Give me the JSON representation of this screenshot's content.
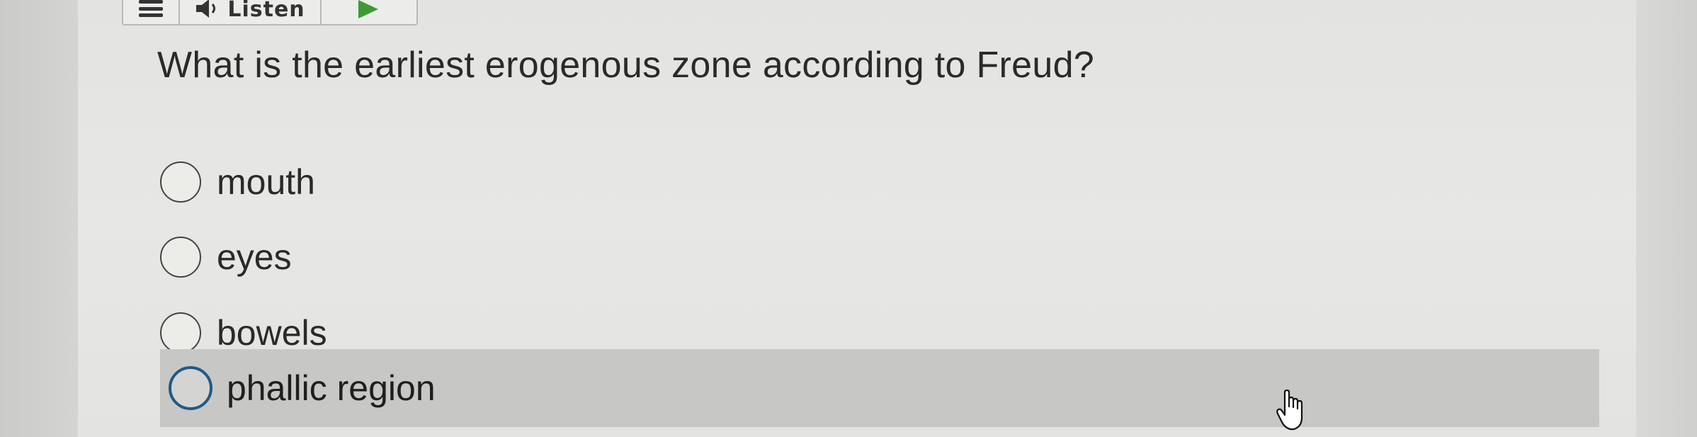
{
  "toolbar": {
    "listen_label": "Listen",
    "icons": [
      "menu-icon",
      "speaker-icon",
      "play-icon"
    ],
    "play_color": "#3d9b35"
  },
  "question": {
    "text": "What is the earliest erogenous zone according to Freud?"
  },
  "options": [
    {
      "label": "mouth"
    },
    {
      "label": "eyes"
    },
    {
      "label": "bowels"
    },
    {
      "label": "phallic region",
      "hovered": true
    }
  ],
  "colors": {
    "hover_background": "#c7c7c5",
    "focus_ring": "#1f5a86"
  }
}
